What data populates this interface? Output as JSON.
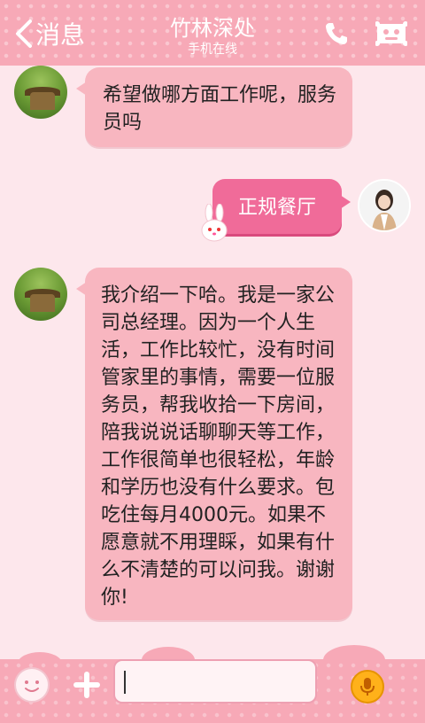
{
  "header": {
    "back_label": "消息",
    "contact_name": "竹林深处",
    "status": "手机在线",
    "icons": [
      "chevron-left-icon",
      "phone-icon",
      "profile-card-icon"
    ]
  },
  "messages": [
    {
      "side": "left",
      "text": "希望做哪方面工作呢，服务员吗"
    },
    {
      "side": "right",
      "text": "正规餐厅"
    },
    {
      "side": "left",
      "text": "我介绍一下哈。我是一家公司总经理。因为一个人生活，工作比较忙，没有时间管家里的事情，需要一位服务员，帮我收拾一下房间，陪我说说话聊聊天等工作，工作很简单也很轻松，年龄和学历也没有什么要求。包吃住每月4000元。如果不愿意就不用理睬，如果有什么不清楚的可以问我。谢谢你!"
    }
  ],
  "input_bar": {
    "value": "",
    "icons": [
      "emoji-icon",
      "plus-icon",
      "microphone-icon"
    ]
  },
  "colors": {
    "header_bg": "#f7a9b7",
    "page_bg": "#fde7ec",
    "bubble_left": "#f8b6c0",
    "bubble_right": "#f06b99",
    "mic": "#ffb11a"
  }
}
